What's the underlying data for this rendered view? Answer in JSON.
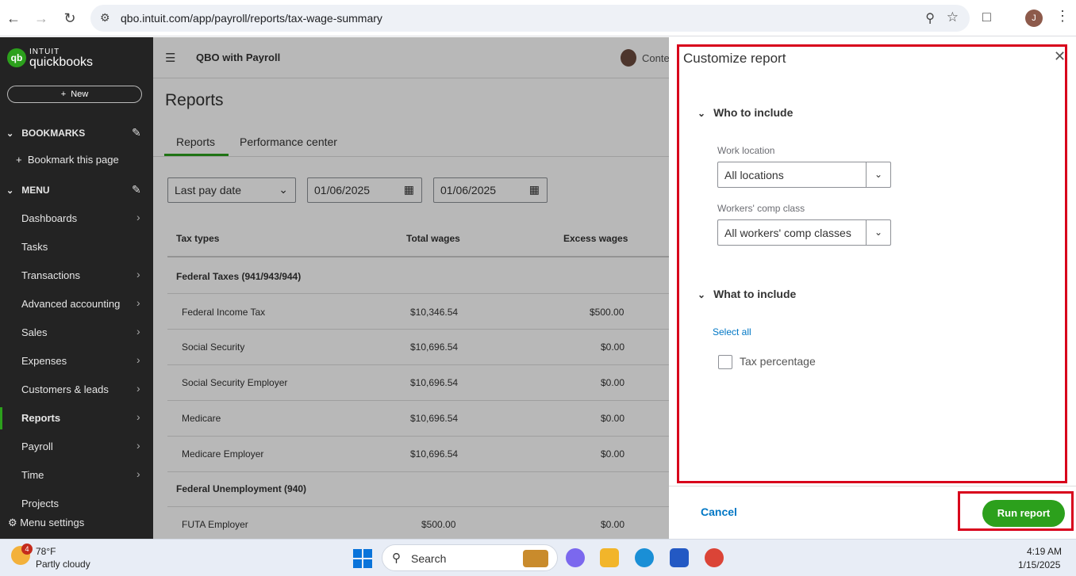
{
  "browser": {
    "url": "qbo.intuit.com/app/payroll/reports/tax-wage-summary",
    "profile_initial": "J"
  },
  "sidebar": {
    "logo_line1": "INTUIT",
    "logo_line2": "quickbooks",
    "logo_mark": "qb",
    "new_label": "New",
    "bookmarks_label": "BOOKMARKS",
    "bookmark_this": "Bookmark this page",
    "menu_label": "MENU",
    "items": [
      {
        "label": "Dashboards",
        "arrow": true
      },
      {
        "label": "Tasks",
        "arrow": false
      },
      {
        "label": "Transactions",
        "arrow": true
      },
      {
        "label": "Advanced accounting",
        "arrow": true
      },
      {
        "label": "Sales",
        "arrow": true
      },
      {
        "label": "Expenses",
        "arrow": true
      },
      {
        "label": "Customers & leads",
        "arrow": true
      },
      {
        "label": "Reports",
        "arrow": true
      },
      {
        "label": "Payroll",
        "arrow": true
      },
      {
        "label": "Time",
        "arrow": true
      },
      {
        "label": "Projects",
        "arrow": false
      }
    ],
    "menu_settings": "Menu settings"
  },
  "main": {
    "company": "QBO with Payroll",
    "contact_partial": "Conte",
    "page_title": "Reports",
    "tabs": [
      "Reports",
      "Performance center"
    ],
    "filter_type": "Last pay date",
    "date_from": "01/06/2025",
    "date_to": "01/06/2025",
    "columns": [
      "Tax types",
      "Total wages",
      "Excess wages"
    ],
    "groups": [
      "Federal Taxes (941/943/944)",
      "Federal Unemployment (940)"
    ],
    "rows": [
      {
        "name": "Federal Income Tax",
        "total": "$10,346.54",
        "excess": "$500.00"
      },
      {
        "name": "Social Security",
        "total": "$10,696.54",
        "excess": "$0.00"
      },
      {
        "name": "Social Security Employer",
        "total": "$10,696.54",
        "excess": "$0.00"
      },
      {
        "name": "Medicare",
        "total": "$10,696.54",
        "excess": "$0.00"
      },
      {
        "name": "Medicare Employer",
        "total": "$10,696.54",
        "excess": "$0.00"
      },
      {
        "name": "FUTA Employer",
        "total": "$500.00",
        "excess": "$0.00"
      }
    ]
  },
  "panel": {
    "title": "Customize report",
    "who_section": "Who to include",
    "work_location_label": "Work location",
    "work_location_value": "All locations",
    "comp_class_label": "Workers' comp class",
    "comp_class_value": "All workers' comp classes",
    "what_section": "What to include",
    "select_all": "Select all",
    "tax_percentage": "Tax percentage",
    "tax_percentage_checked": false,
    "cancel_label": "Cancel",
    "run_label": "Run report",
    "highlight_color": "#d8001b",
    "accent_color": "#2ca01c"
  },
  "taskbar": {
    "weather_badge": "4",
    "temperature": "78°F",
    "condition": "Partly cloudy",
    "search_label": "Search",
    "time": "4:19 AM",
    "date": "1/15/2025"
  }
}
